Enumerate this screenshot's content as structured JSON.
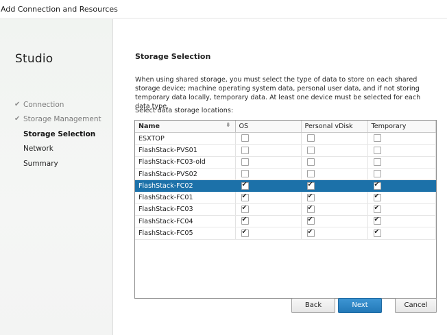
{
  "window": {
    "title": "Add Connection and Resources"
  },
  "sidebar": {
    "app_name": "Studio",
    "steps": [
      {
        "label": "Connection",
        "state": "done"
      },
      {
        "label": "Storage Management",
        "state": "done"
      },
      {
        "label": "Storage Selection",
        "state": "current"
      },
      {
        "label": "Network",
        "state": "todo"
      },
      {
        "label": "Summary",
        "state": "todo"
      }
    ]
  },
  "page": {
    "heading": "Storage Selection",
    "description": "When using shared storage, you must select the type of data to store on each shared storage device; machine operating system data, personal user data, and if not storing temporary data locally, temporary data. At least one device must be selected for each data type.",
    "select_label": "Select data storage locations:"
  },
  "table": {
    "columns": [
      "Name",
      "OS",
      "Personal vDisk",
      "Temporary"
    ],
    "rows": [
      {
        "name": "ESXTOP",
        "os": false,
        "pvd": false,
        "temp": false,
        "selected": false
      },
      {
        "name": "FlashStack-PVS01",
        "os": false,
        "pvd": false,
        "temp": false,
        "selected": false
      },
      {
        "name": "FlashStack-FC03-old",
        "os": false,
        "pvd": false,
        "temp": false,
        "selected": false
      },
      {
        "name": "FlashStack-PVS02",
        "os": false,
        "pvd": false,
        "temp": false,
        "selected": false
      },
      {
        "name": "FlashStack-FC02",
        "os": true,
        "pvd": true,
        "temp": true,
        "selected": true
      },
      {
        "name": "FlashStack-FC01",
        "os": true,
        "pvd": true,
        "temp": true,
        "selected": false
      },
      {
        "name": "FlashStack-FC03",
        "os": true,
        "pvd": true,
        "temp": true,
        "selected": false
      },
      {
        "name": "FlashStack-FC04",
        "os": true,
        "pvd": true,
        "temp": true,
        "selected": false
      },
      {
        "name": "FlashStack-FC05",
        "os": true,
        "pvd": true,
        "temp": true,
        "selected": false
      }
    ]
  },
  "buttons": {
    "back": "Back",
    "next": "Next",
    "cancel": "Cancel"
  },
  "colors": {
    "selection": "#1c71a9",
    "primary_button": "#2a83c4"
  }
}
